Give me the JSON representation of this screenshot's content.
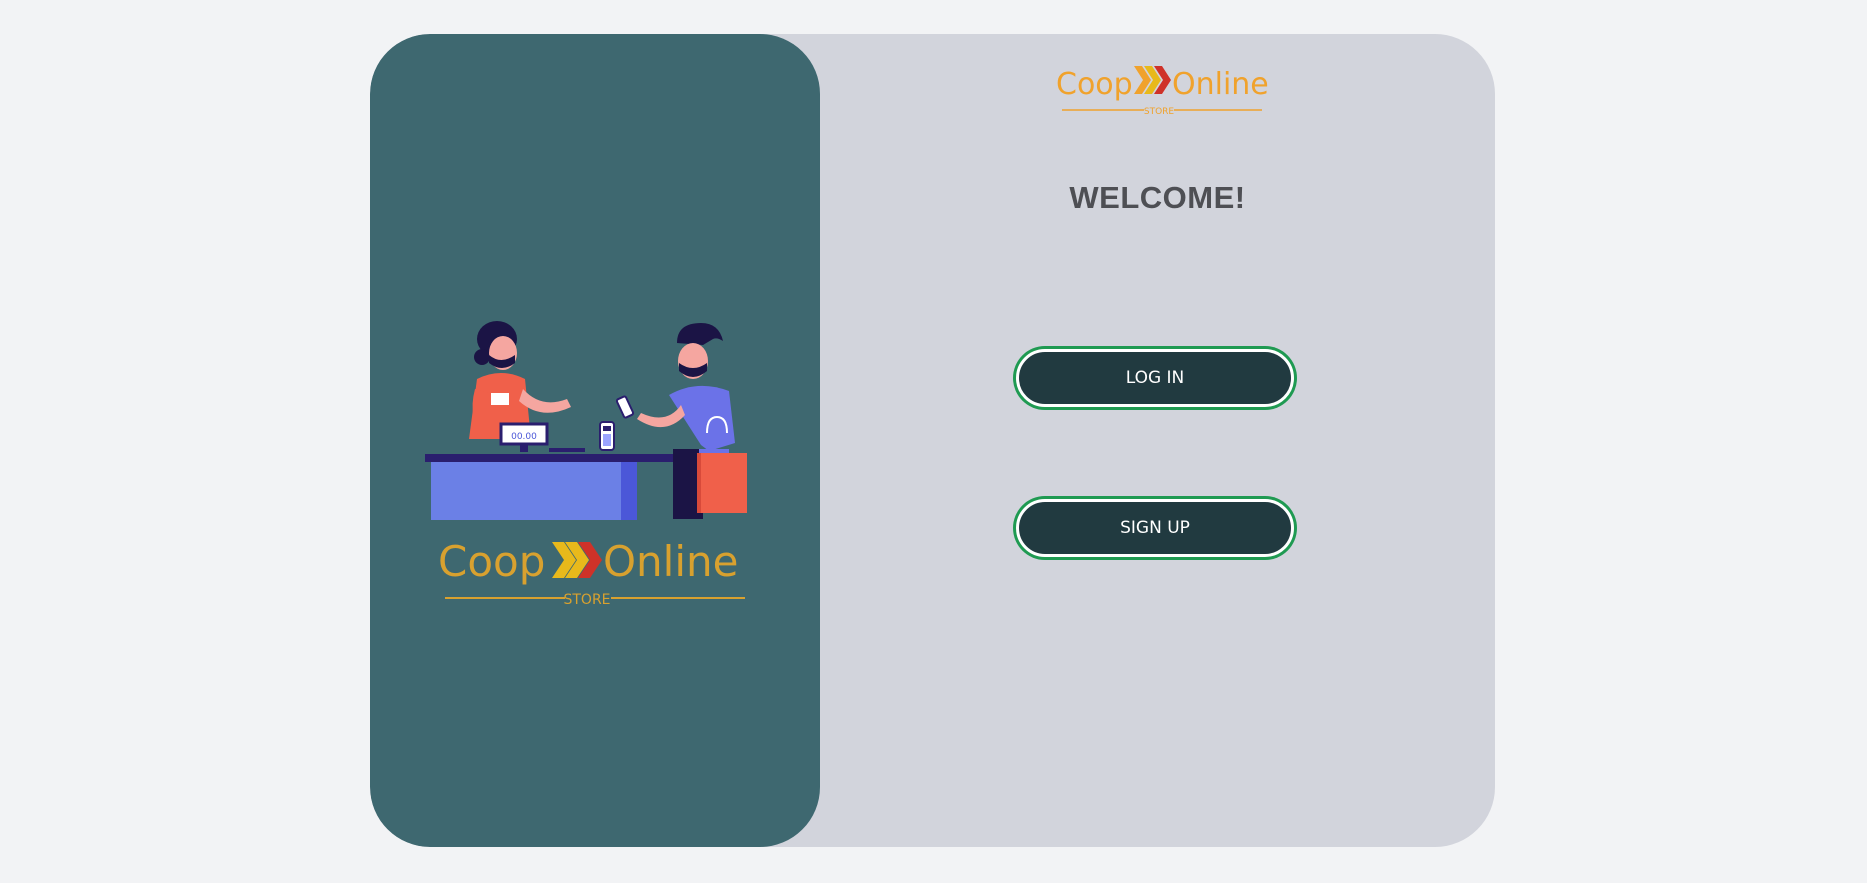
{
  "brand": {
    "logo_word_left": "Coop",
    "logo_word_right": "Online",
    "logo_subtitle": "STORE",
    "colors": {
      "orange": "#f0a22c",
      "yellow": "#e8b91b",
      "red": "#cf3229",
      "dark_teal": "#3e6870"
    }
  },
  "illustration": {
    "register_display": "00.00",
    "icon": "cashier-checkout-illustration"
  },
  "main": {
    "welcome_title": "WELCOME!",
    "login_label": "LOG IN",
    "signup_label": "SIGN UP"
  }
}
